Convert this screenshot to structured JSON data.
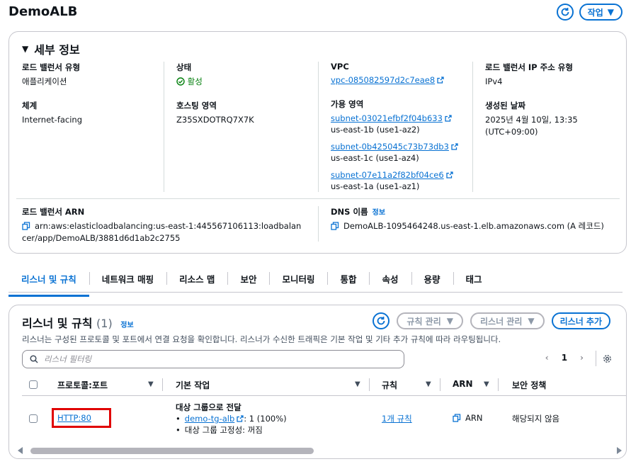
{
  "page": {
    "title": "DemoALB"
  },
  "top_actions": {
    "actions_label": "작업"
  },
  "details": {
    "header": "세부 정보",
    "lb_type": {
      "label": "로드 밸런서 유형",
      "value": "애플리케이션"
    },
    "scheme": {
      "label": "체계",
      "value": "Internet-facing"
    },
    "status": {
      "label": "상태",
      "value": "활성"
    },
    "hosted_zone": {
      "label": "호스팅 영역",
      "value": "Z35SXDOTRQ7X7K"
    },
    "vpc": {
      "label": "VPC",
      "value": "vpc-085082597d2c7eae8"
    },
    "az": {
      "label": "가용 영역",
      "items": [
        {
          "subnet": "subnet-03021efbf2f04b633",
          "zone": "us-east-1b (use1-az2)"
        },
        {
          "subnet": "subnet-0b425045c73b73db3",
          "zone": "us-east-1c (use1-az4)"
        },
        {
          "subnet": "subnet-07e11a2f82bf04ce6",
          "zone": "us-east-1a (use1-az1)"
        }
      ]
    },
    "ip_type": {
      "label": "로드 밸런서 IP 주소 유형",
      "value": "IPv4"
    },
    "created": {
      "label": "생성된 날짜",
      "value": "2025년 4월 10일, 13:35 (UTC+09:00)"
    },
    "arn": {
      "label": "로드 밸런서 ARN",
      "value": "arn:aws:elasticloadbalancing:us-east-1:445567106113:loadbalancer/app/DemoALB/3881d6d1ab2c2755"
    },
    "dns": {
      "label": "DNS 이름",
      "info": "정보",
      "value": "DemoALB-1095464248.us-east-1.elb.amazonaws.com (A 레코드)"
    }
  },
  "tabs": [
    "리스너 및 규칙",
    "네트워크 매핑",
    "리소스 맵",
    "보안",
    "모니터링",
    "통합",
    "속성",
    "용량",
    "태그"
  ],
  "listeners": {
    "title": "리스너 및 규칙",
    "count": "(1)",
    "info": "정보",
    "description": "리스너는 구성된 프로토콜 및 포트에서 연결 요청을 확인합니다. 리스너가 수신한 트래픽은 기본 작업 및 기타 추가 규칙에 따라 라우팅됩니다.",
    "manage_rules": "규칙 관리",
    "manage_listener": "리스너 관리",
    "add_listener": "리스너 추가",
    "filter_placeholder": "리스너 필터링",
    "page": "1",
    "columns": {
      "protocol_port": "프로토콜:포트",
      "default_action": "기본 작업",
      "rules": "규칙",
      "arn": "ARN",
      "security_policy": "보안 정책"
    },
    "row": {
      "protocol_port": "HTTP:80",
      "action_title": "대상 그룹으로 전달",
      "target_group": "demo-tg-alb",
      "weight": ": 1 (100%)",
      "stickiness": "대상 그룹 고정성: 꺼짐",
      "rules": "1개 규칙",
      "arn": "ARN",
      "security_policy": "해당되지 않음"
    }
  },
  "colors": {
    "accent": "#0972d3",
    "success": "#037f0c",
    "highlight": "#e00000"
  }
}
